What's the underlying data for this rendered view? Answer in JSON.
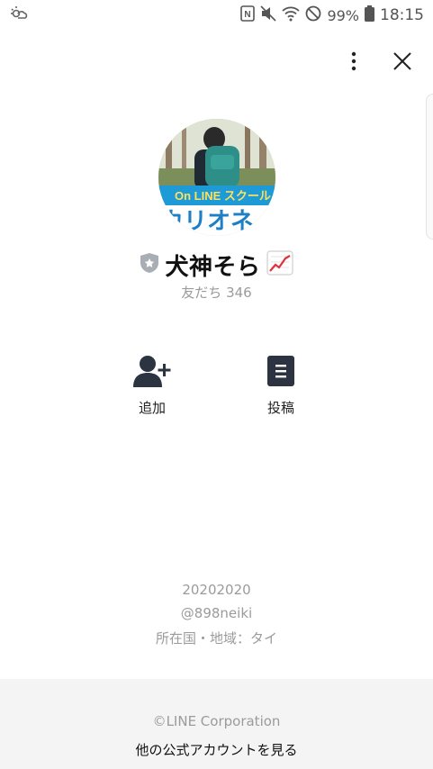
{
  "status_bar": {
    "left_icon": "weather-icon",
    "icons": [
      "nfc-icon",
      "mute-icon",
      "wifi-icon",
      "do-not-disturb-icon",
      "battery-icon"
    ],
    "battery": "99%",
    "time": "18:15"
  },
  "top_actions": {
    "more_icon": "more-vertical-icon",
    "close_icon": "close-icon"
  },
  "avatar": {
    "banner_line1": "On LINE スクール",
    "banner_line2": "カリオネ"
  },
  "profile": {
    "name": "犬神そら",
    "badge_icon": "shield-star-icon",
    "trend_icon": "chart-increasing-icon",
    "friends": "友だち 346"
  },
  "actions": [
    {
      "label": "追加",
      "icon": "add-friend-icon"
    },
    {
      "label": "投稿",
      "icon": "posts-icon"
    }
  ],
  "info": {
    "line1": "20202020",
    "line2": "@898neiki",
    "line3": "所在国・地域：タイ"
  },
  "footer": {
    "copyright": "©LINE Corporation",
    "link": "他の公式アカウントを見る"
  },
  "colors": {
    "muted_text": "#9b9b9b",
    "icon_dark": "#2b3440",
    "footer_bg": "#f4f4f4"
  }
}
